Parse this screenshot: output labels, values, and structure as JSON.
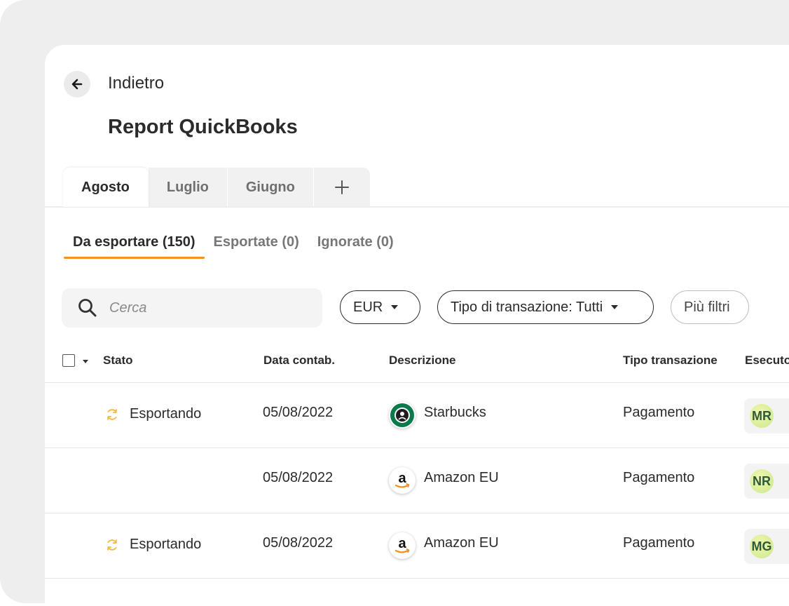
{
  "header": {
    "back_label": "Indietro",
    "title": "Report QuickBooks"
  },
  "month_tabs": [
    {
      "label": "Agosto",
      "active": true
    },
    {
      "label": "Luglio",
      "active": false
    },
    {
      "label": "Giugno",
      "active": false
    },
    {
      "label": "+",
      "active": false
    }
  ],
  "status_tabs": [
    {
      "label": "Da esportare (150)",
      "active": true
    },
    {
      "label": "Esportate (0)",
      "active": false
    },
    {
      "label": "Ignorate (0)",
      "active": false
    }
  ],
  "filters": {
    "search_placeholder": "Cerca",
    "currency": "EUR",
    "transaction_type": "Tipo di transazione: Tutti",
    "more_filters": "Più filtri"
  },
  "table": {
    "columns": {
      "status": "Stato",
      "date": "Data contab.",
      "description": "Descrizione",
      "type": "Tipo transazione",
      "executor": "Esecutore"
    },
    "rows": [
      {
        "status": "Esportando",
        "date": "05/08/2022",
        "merchant": "Starbucks",
        "logo": "starbucks-logo",
        "type": "Pagamento",
        "executor": "MR"
      },
      {
        "status": "",
        "date": "05/08/2022",
        "merchant": "Amazon  EU",
        "logo": "amazon-logo",
        "type": "Pagamento",
        "executor": "NR"
      },
      {
        "status": "Esportando",
        "date": "05/08/2022",
        "merchant": "Amazon  EU",
        "logo": "amazon-logo",
        "type": "Pagamento",
        "executor": "MG"
      }
    ]
  },
  "colors": {
    "accent": "#f39020",
    "sync_icon": "#f5b840",
    "starbucks": "#0b7a4b",
    "avatar_text": "#2e5a3a"
  }
}
